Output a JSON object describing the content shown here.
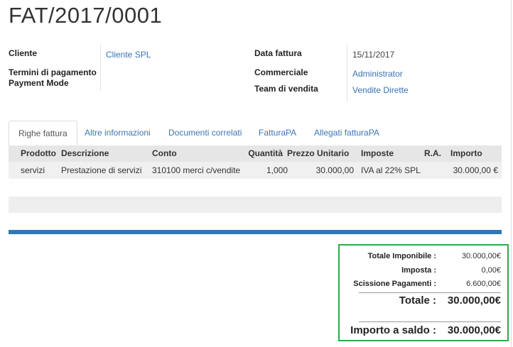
{
  "title": "FAT/2017/0001",
  "header": {
    "cliente_label": "Cliente",
    "cliente_value": "Cliente SPL",
    "termini_label": "Termini di pagamento",
    "payment_mode_label": "Payment Mode",
    "data_fattura_label": "Data fattura",
    "data_fattura_value": "15/11/2017",
    "commerciale_label": "Commerciale",
    "commerciale_value": "Administrator",
    "team_label": "Team di vendita",
    "team_value": "Vendite Dirette"
  },
  "tabs": [
    {
      "label": "Righe fattura",
      "active": true
    },
    {
      "label": "Altre informazioni",
      "active": false
    },
    {
      "label": "Documenti correlati",
      "active": false
    },
    {
      "label": "FatturaPA",
      "active": false
    },
    {
      "label": "Allegati fatturaPA",
      "active": false
    }
  ],
  "table": {
    "columns": [
      "Prodotto",
      "Descrizione",
      "Conto",
      "Quantità",
      "Prezzo Unitario",
      "Imposte",
      "R.A.",
      "Importo"
    ],
    "rows": [
      [
        "servizi",
        "Prestazione di servizi",
        "310100 merci c/vendite",
        "1,000",
        "30.000,00",
        "IVA al 22% SPL",
        "",
        "30.000,00 €"
      ]
    ]
  },
  "totals": {
    "imponibile_label": "Totale Imponibile :",
    "imponibile_value": "30.000,00€",
    "imposta_label": "Imposta :",
    "imposta_value": "0,00€",
    "scissione_label": "Scissione Pagamenti :",
    "scissione_value": "6.600,00€",
    "totale_label": "Totale :",
    "totale_value": "30.000,00€",
    "saldo_label": "Importo a saldo :",
    "saldo_value": "30.000,00€"
  },
  "colors": {
    "link": "#3873b4",
    "accent_band": "#2e78b4",
    "highlight_border": "#2eaa4a"
  }
}
